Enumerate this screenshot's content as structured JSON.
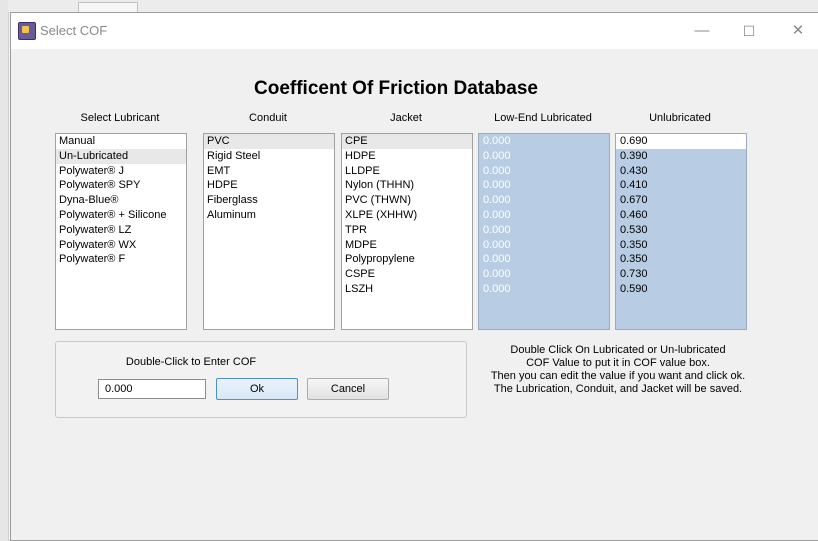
{
  "window": {
    "title": "Select COF",
    "minimize_glyph": "—",
    "maximize_glyph": "☐",
    "close_glyph": "✕"
  },
  "main_title": "Coefficent Of Friction Database",
  "headers": {
    "lubricant": "Select Lubricant",
    "conduit": "Conduit",
    "jacket": "Jacket",
    "low_end": "Low-End Lubricated",
    "unlubricated": "Unlubricated"
  },
  "lubricants": [
    "Manual",
    "Un-Lubricated",
    "Polywater® J",
    "Polywater® SPY",
    "Dyna-Blue®",
    "Polywater® + Silicone",
    "Polywater® LZ",
    "Polywater® WX",
    "Polywater® F"
  ],
  "conduits": [
    "PVC",
    "Rigid Steel",
    "EMT",
    "HDPE",
    "Fiberglass",
    "Aluminum"
  ],
  "jackets": [
    "CPE",
    "HDPE",
    "LLDPE",
    "Nylon (THHN)",
    "PVC (THWN)",
    "XLPE (XHHW)",
    "TPR",
    "MDPE",
    "Polypropylene",
    "CSPE",
    "LSZH"
  ],
  "low_end_values": [
    "0.000",
    "0.000",
    "0.000",
    "0.000",
    "0.000",
    "0.000",
    "0.000",
    "0.000",
    "0.000",
    "0.000",
    "0.000"
  ],
  "unlubricated_values": [
    "0.690",
    "0.390",
    "0.430",
    "0.410",
    "0.670",
    "0.460",
    "0.530",
    "0.350",
    "0.350",
    "0.730",
    "0.590"
  ],
  "entry": {
    "label": "Double-Click to Enter COF",
    "value": "0.000",
    "ok_label": "Ok",
    "cancel_label": "Cancel"
  },
  "help_lines": [
    "Double Click On Lubricated or Un-lubricated",
    "COF Value to put it in COF value box.",
    "Then you can edit the value if you want and click ok.",
    "The Lubrication, Conduit, and Jacket will be saved."
  ],
  "colors": {
    "value_box_bg": "#b8cde4",
    "selected_row_bg": "#e8e8e8",
    "ok_border": "#4d8fd1"
  }
}
